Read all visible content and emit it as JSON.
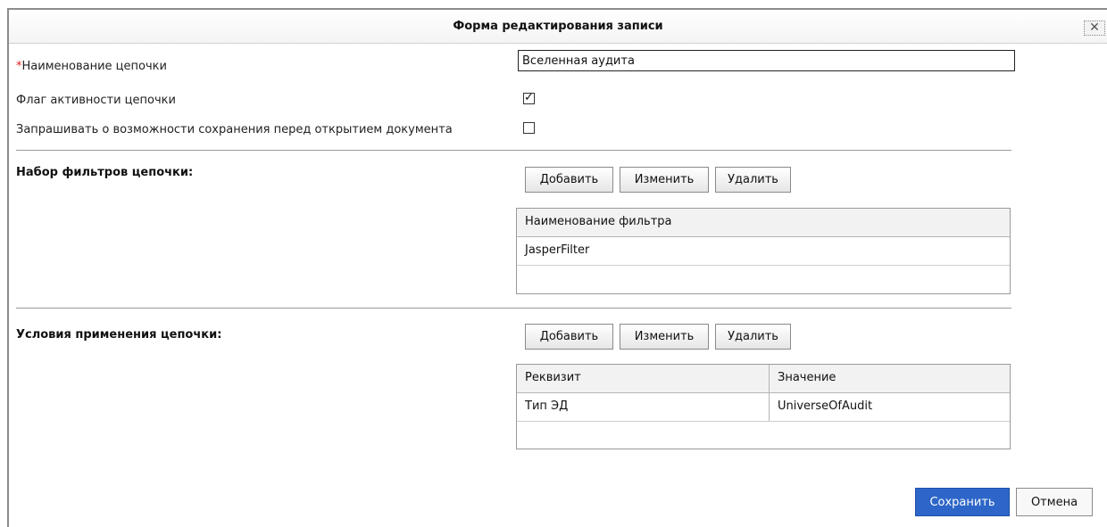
{
  "dialog": {
    "title": "Форма редактирования записи",
    "close_glyph": "✕"
  },
  "form": {
    "required_mark": "*",
    "chain_name_label": "Наименование цепочки",
    "chain_name_value": "Вселенная аудита",
    "active_flag_label": "Флаг активности цепочки",
    "active_flag_checked": true,
    "ask_save_label": "Запрашивать о возможности сохранения перед открытием документа",
    "ask_save_checked": false
  },
  "filters": {
    "section_label": "Набор фильтров цепочки:",
    "add_label": "Добавить",
    "edit_label": "Изменить",
    "delete_label": "Удалить",
    "columns": [
      "Наименование фильтра"
    ],
    "rows": [
      [
        "JasperFilter"
      ]
    ]
  },
  "conditions": {
    "section_label": "Условия применения цепочки:",
    "add_label": "Добавить",
    "edit_label": "Изменить",
    "delete_label": "Удалить",
    "columns": [
      "Реквизит",
      "Значение"
    ],
    "rows": [
      [
        "Тип ЭД",
        "UniverseOfAudit"
      ]
    ]
  },
  "footer": {
    "save_label": "Сохранить",
    "cancel_label": "Отмена"
  },
  "colors": {
    "primary_button": "#2d66c8",
    "required_mark": "#e0201c"
  },
  "icons": {
    "close": "close-icon",
    "check": "checkmark-icon"
  }
}
